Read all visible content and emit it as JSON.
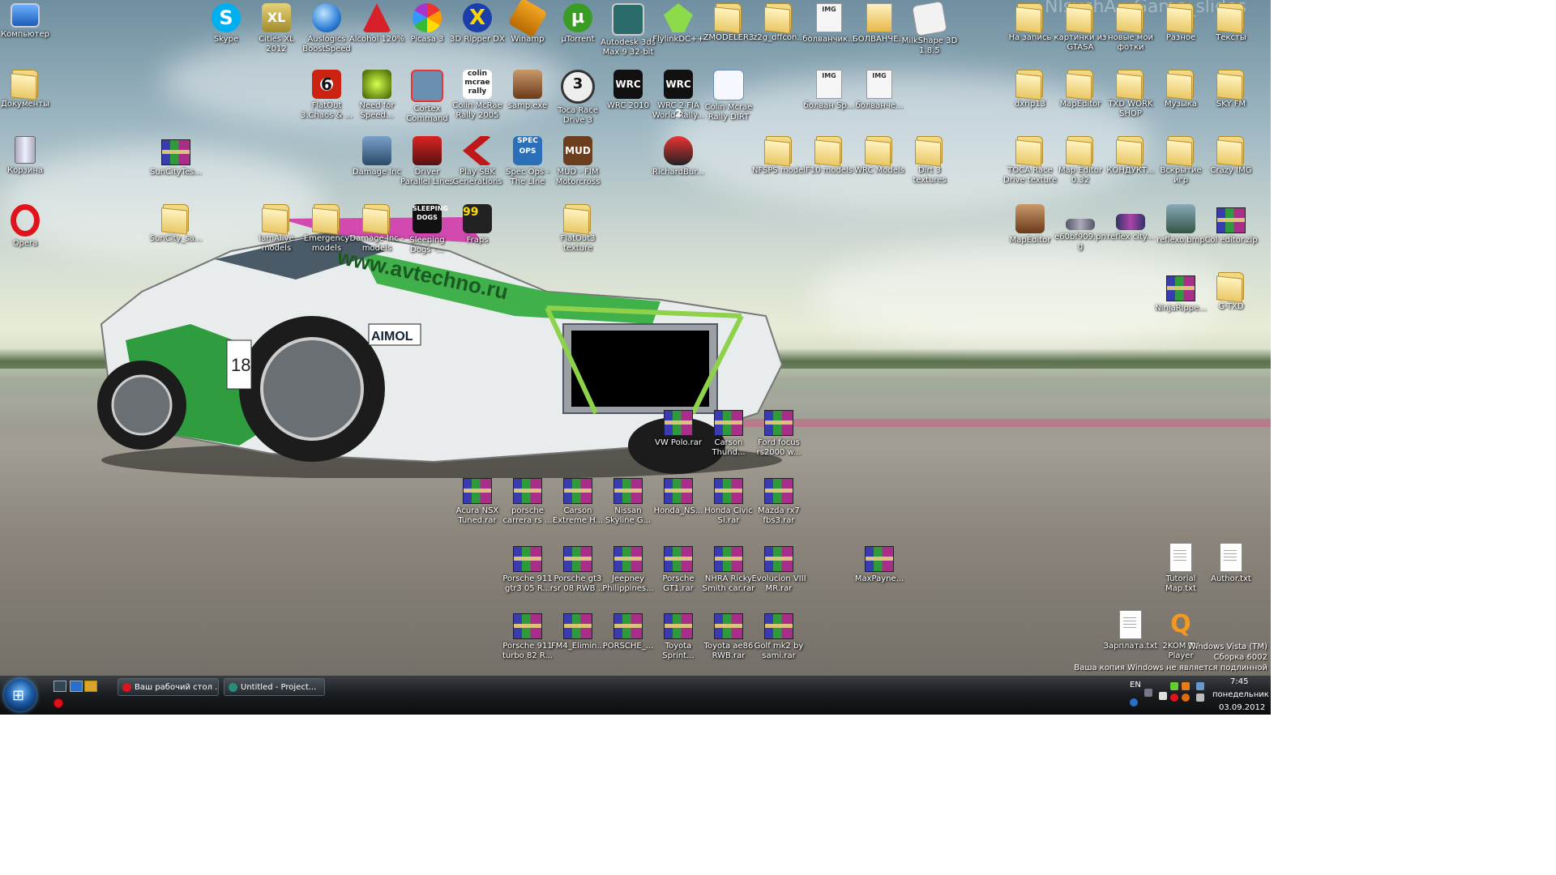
{
  "watermark": "NIsychA : Game_slides",
  "icons_col1": [
    {
      "label": "Компьютер"
    },
    {
      "label": "Документы"
    },
    {
      "label": "Корзина"
    },
    {
      "label": "Opera"
    }
  ],
  "icons_row1": [
    {
      "label": "Skype"
    },
    {
      "label": "Cities XL 2012"
    },
    {
      "label": "Auslogics BoostSpeed"
    },
    {
      "label": "Alcohol 120%"
    },
    {
      "label": "Picasa 3"
    },
    {
      "label": "3D Ripper DX"
    },
    {
      "label": "Winamp"
    },
    {
      "label": "µTorrent"
    },
    {
      "label": "Autodesk 3ds Max 9 32-bit"
    },
    {
      "label": "FlylinkDC++"
    },
    {
      "label": "ZMODELER3"
    },
    {
      "label": "z2g_dffcon..."
    },
    {
      "label": "болванчик..."
    },
    {
      "label": "БОЛВАНЧЕ..."
    },
    {
      "label": "MilkShape 3D 1.8.5"
    }
  ],
  "icons_row2": [
    {
      "label": "FlatOut 3.Chaos & ..."
    },
    {
      "label": "Need for Speed..."
    },
    {
      "label": "Cortex Command"
    },
    {
      "label": "Colin McRae Rally 2005"
    },
    {
      "label": "samp.exe"
    },
    {
      "label": "Toca Race Drive 3"
    },
    {
      "label": "WRC 2010"
    },
    {
      "label": "WRC 2 FIA World Rally..."
    },
    {
      "label": "Colin Mcrae Rally DIRT"
    },
    {
      "label": "болван Sp..."
    },
    {
      "label": "болванче..."
    }
  ],
  "icons_row3": [
    {
      "label": "SunCityTes..."
    },
    {
      "label": "Damage Inc"
    },
    {
      "label": "Driver Parallel Lines"
    },
    {
      "label": "Play SBK Generations"
    },
    {
      "label": "Spec Ops - The Line"
    },
    {
      "label": "MUD - FIM Motorcross"
    },
    {
      "label": "RichardBur..."
    },
    {
      "label": "NFSPS model"
    },
    {
      "label": "F10 models"
    },
    {
      "label": "WRC Models"
    },
    {
      "label": "Dirt 3 textures"
    }
  ],
  "icons_row4": [
    {
      "label": "SunCity_sa..."
    },
    {
      "label": "IamAlive models"
    },
    {
      "label": "Emergency models"
    },
    {
      "label": "Damage Inc - models"
    },
    {
      "label": "Sleeping Dogs -..."
    },
    {
      "label": "Fraps"
    },
    {
      "label": "FlatOut3 texture"
    }
  ],
  "icons_right": [
    {
      "label": "На запись"
    },
    {
      "label": "картинки из GTASA"
    },
    {
      "label": "новые мои фотки"
    },
    {
      "label": "Разное"
    },
    {
      "label": "Тексты"
    },
    {
      "label": "dxrip13"
    },
    {
      "label": "MapEditor"
    },
    {
      "label": "TXD WORK SHOP"
    },
    {
      "label": "Музыка"
    },
    {
      "label": "SKY FM"
    },
    {
      "label": "TOCA Race Drive texture"
    },
    {
      "label": "Map Editor 0.32"
    },
    {
      "label": "КОНДУКТ..."
    },
    {
      "label": "Вскрытие игр"
    },
    {
      "label": "Crazy IMG"
    },
    {
      "label": "MapEditor"
    },
    {
      "label": "e60bf909.png"
    },
    {
      "label": "reflex city..."
    },
    {
      "label": "reflexo.bmp"
    },
    {
      "label": "Col editor.zip"
    },
    {
      "label": "NinjaRippe..."
    },
    {
      "label": "G-TXD"
    }
  ],
  "rar_files": [
    {
      "label": "VW Polo.rar"
    },
    {
      "label": "Carson Thund..."
    },
    {
      "label": "Ford focus rs2000 w..."
    },
    {
      "label": "Acura NSX Tuned.rar"
    },
    {
      "label": "porsche carrera rs ..."
    },
    {
      "label": "Carson Extreme H..."
    },
    {
      "label": "Nissan Skyline G..."
    },
    {
      "label": "Honda_NS..."
    },
    {
      "label": "Honda Civic Si.rar"
    },
    {
      "label": "Mazda rx7 fbs3.rar"
    },
    {
      "label": "Porsche 911 gtr3 05 R..."
    },
    {
      "label": "Porsche gt3 rsr 08 RWB ..."
    },
    {
      "label": "Jeepney Philippines..."
    },
    {
      "label": "Porsche GT1.rar"
    },
    {
      "label": "NHRA Ricky Smith car.rar"
    },
    {
      "label": "Evolucion VIII MR.rar"
    },
    {
      "label": "MaxPayne..."
    },
    {
      "label": "Porsche 911 turbo 82 R..."
    },
    {
      "label": "FM4_Elimin..."
    },
    {
      "label": "PORSCHE_..."
    },
    {
      "label": "Toyota Sprint..."
    },
    {
      "label": "Toyota ae86 RWB.rar"
    },
    {
      "label": "Golf mk2 by sami.rar"
    }
  ],
  "files_right": [
    {
      "label": "Tutorial Map.txt"
    },
    {
      "label": "Author.txt"
    },
    {
      "label": "Зарплата.txt"
    },
    {
      "label": "2KOM TV Player"
    }
  ],
  "vista_notice": {
    "line1": "Windows Vista (TM)",
    "line2": "Сборка 6002",
    "line3": "Ваша копия Windows не является подлинной"
  },
  "taskbar": {
    "tasks": [
      {
        "label": "Ваш рабочий стол ..."
      },
      {
        "label": "Untitled      - Project..."
      }
    ],
    "lang": "EN",
    "time": "7:45",
    "day": "понедельник",
    "date": "03.09.2012"
  },
  "colors": {
    "icon_text": "#ffffff",
    "taskbar": "#1b1e21",
    "start_orb": "#1e5da8"
  }
}
